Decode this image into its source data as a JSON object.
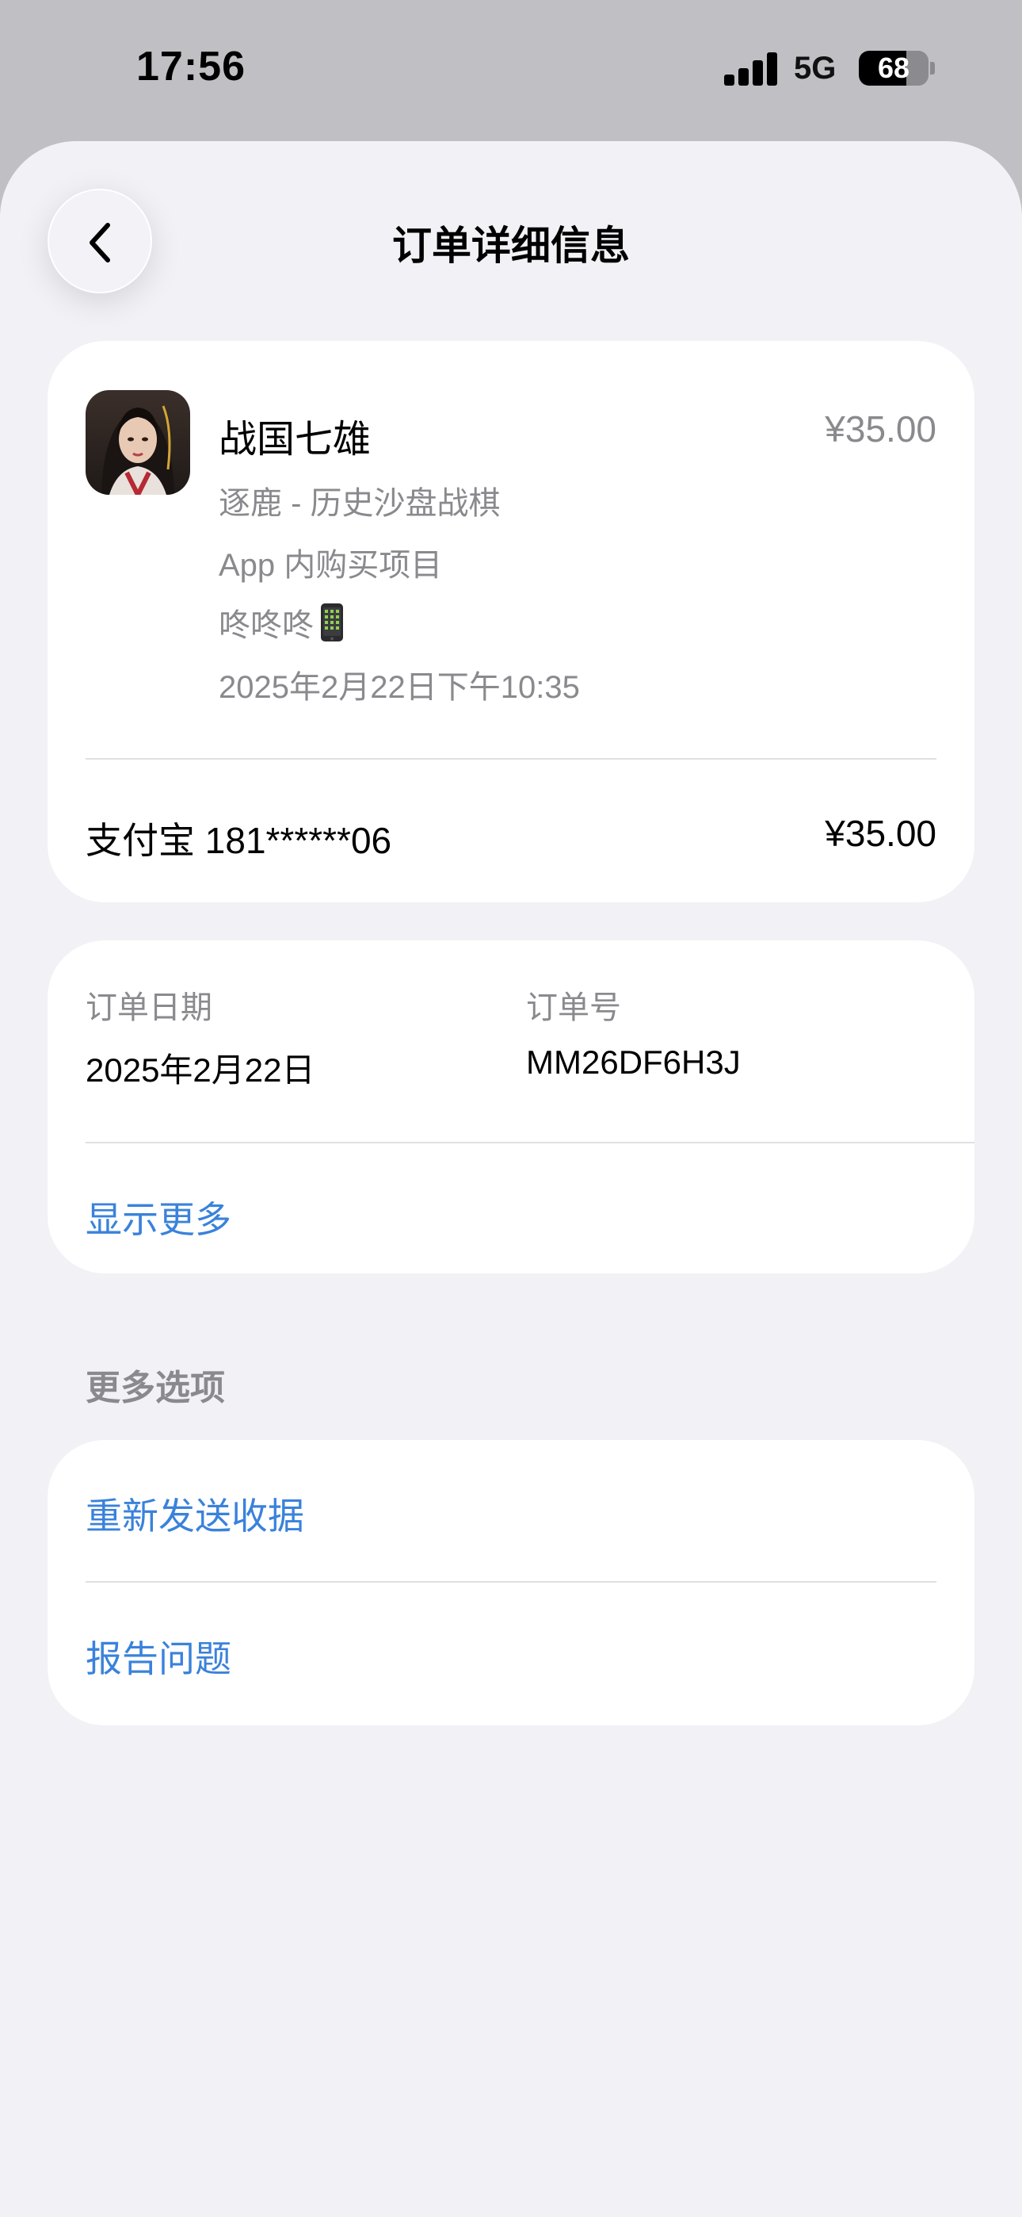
{
  "status_bar": {
    "time": "17:56",
    "network": "5G",
    "battery": "68",
    "battery_level": 0.68,
    "signal_icon": "cellular-signal-icon"
  },
  "nav": {
    "back_icon": "chevron-left-icon",
    "title": "订单详细信息"
  },
  "purchase": {
    "app_icon": "app-icon-portrait",
    "title": "战国七雄",
    "price": "¥35.00",
    "subtitle": "逐鹿 - 历史沙盘战棋",
    "type": "App 内购买项目",
    "device_name": "咚咚咚",
    "device_icon": "mobile-phone-icon",
    "date_time": "2025年2月22日下午10:35",
    "payment_method": "支付宝 181******06",
    "payment_amount": "¥35.00"
  },
  "order": {
    "date_label": "订单日期",
    "date_value": "2025年2月22日",
    "id_label": "订单号",
    "id_value": "MM26DF6H3J",
    "show_more": "显示更多"
  },
  "more_options": {
    "header": "更多选项",
    "resend_receipt": "重新发送收据",
    "report_problem": "报告问题"
  },
  "colors": {
    "sheet_background": "#f1f1f6",
    "link_blue": "#3a82db",
    "secondary_text": "#8a8a8e"
  }
}
